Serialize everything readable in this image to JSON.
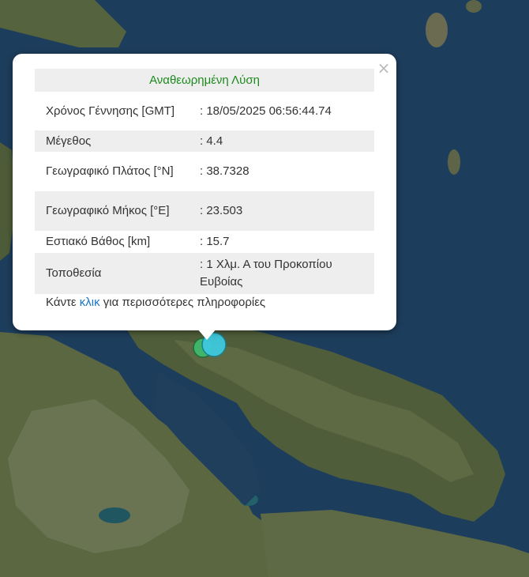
{
  "popup": {
    "title": "Αναθεωρημένη Λύση",
    "close_glyph": "×",
    "rows": [
      {
        "label": "Χρόνος Γέννησης [GMT]",
        "value": ": 18/05/2025 06:56:44.74"
      },
      {
        "label": "Μέγεθος",
        "value": ": 4.4"
      },
      {
        "label": "Γεωγραφικό Πλάτος [°N]",
        "value": ": 38.7328"
      },
      {
        "label": "Γεωγραφικό Μήκος [°E]",
        "value": ": 23.503"
      },
      {
        "label": "Εστιακό Βάθος [km]",
        "value": ": 15.7"
      },
      {
        "label": "Τοποθεσία",
        "value": ": 1 Χλμ. Α του Προκοπίου Ευβοίας"
      }
    ],
    "footer_prefix": "Κάντε",
    "footer_link": "κλικ",
    "footer_suffix": "για περισσότερες πληροφορίες"
  },
  "markers": [
    {
      "name": "epicenter-green",
      "color": "#3fb86b"
    },
    {
      "name": "epicenter-cyan",
      "color": "#3ec9dd"
    }
  ],
  "colors": {
    "sea": "#1d3d5c",
    "land": "#4a5a37",
    "title_green": "#1d8a1d",
    "link_blue": "#1a75c9"
  }
}
